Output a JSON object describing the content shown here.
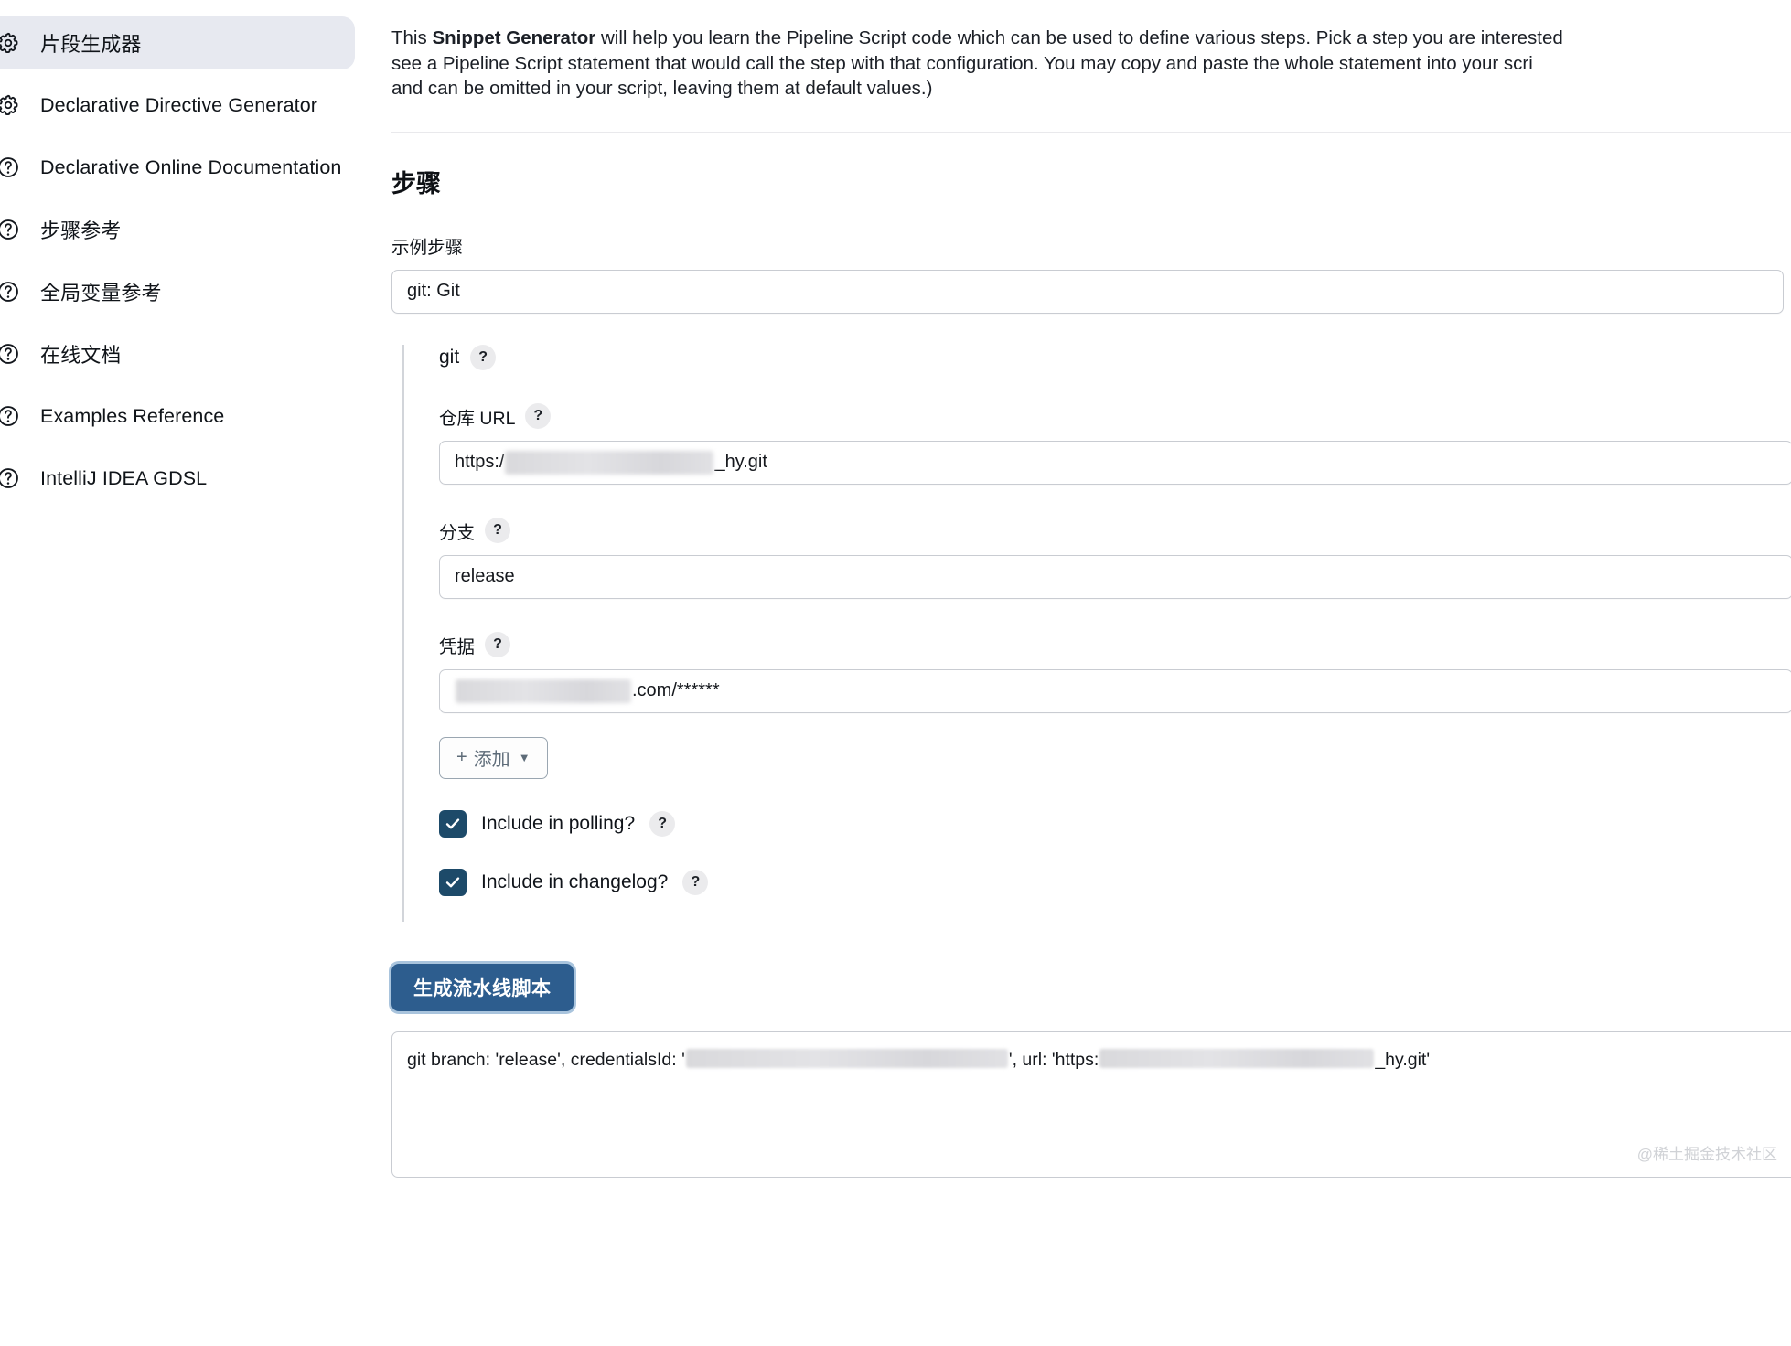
{
  "sidebar": {
    "items": [
      {
        "label": "片段生成器",
        "icon": "gear-icon",
        "active": true,
        "cjk": true
      },
      {
        "label": "Declarative Directive Generator",
        "icon": "gear-icon",
        "active": false,
        "cjk": false
      },
      {
        "label": "Declarative Online Documentation",
        "icon": "question-icon",
        "active": false,
        "cjk": false
      },
      {
        "label": "步骤参考",
        "icon": "question-icon",
        "active": false,
        "cjk": true
      },
      {
        "label": "全局变量参考",
        "icon": "question-icon",
        "active": false,
        "cjk": true
      },
      {
        "label": "在线文档",
        "icon": "question-icon",
        "active": false,
        "cjk": true
      },
      {
        "label": "Examples Reference",
        "icon": "question-icon",
        "active": false,
        "cjk": false
      },
      {
        "label": "IntelliJ IDEA GDSL",
        "icon": "question-icon",
        "active": false,
        "cjk": false
      }
    ]
  },
  "intro": {
    "line1_prefix": "This ",
    "line1_bold": "Snippet Generator",
    "line1_suffix": " will help you learn the Pipeline Script code which can be used to define various steps. Pick a step you are interested",
    "line2": "see a Pipeline Script statement that would call the step with that configuration. You may copy and paste the whole statement into your scri",
    "line3": "and can be omitted in your script, leaving them at default values.)"
  },
  "section": {
    "title": "步骤",
    "sample_step_label": "示例步骤",
    "sample_step_value": "git: Git"
  },
  "git_group": {
    "header": "git",
    "help": "?",
    "fields": {
      "repo_url": {
        "label": "仓库 URL",
        "help": "?",
        "value_prefix": "https:/",
        "value_suffix": "_hy.git",
        "redacted": true
      },
      "branch": {
        "label": "分支",
        "help": "?",
        "value": "release"
      },
      "credentials": {
        "label": "凭据",
        "help": "?",
        "value_prefix": "",
        "value_suffix": ".com/******",
        "redacted": true
      }
    },
    "add_button": {
      "plus": "+",
      "label": "添加",
      "caret": "▼"
    },
    "checkboxes": [
      {
        "label": "Include in polling?",
        "checked": true,
        "help": "?"
      },
      {
        "label": "Include in changelog?",
        "checked": true,
        "help": "?"
      }
    ]
  },
  "generate": {
    "button_label": "生成流水线脚本",
    "output_prefix": "git branch: 'release', credentialsId: '",
    "output_mid": "', url: 'https:",
    "output_suffix": "_hy.git'"
  },
  "watermark": "@稀土掘金技术社区",
  "colors": {
    "accent_button": "#2d5d8e",
    "checkbox": "#1d4a69",
    "active_nav_bg": "#e7e9f0",
    "border": "#c9ccd2"
  }
}
